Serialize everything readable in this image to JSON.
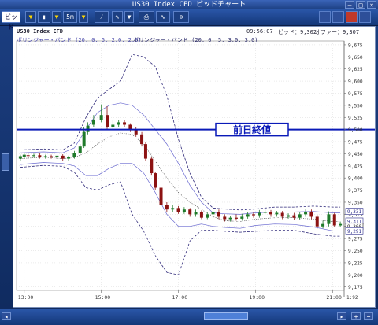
{
  "window": {
    "title": "US30 Index CFD ビッドチャート"
  },
  "toolbar": {
    "bid_label": "ビッド",
    "period_label": "5m"
  },
  "chart_header": {
    "symbol_label": "US30 Index CFD",
    "time": "09:56:07",
    "bid_label": "ビッド：9,302",
    "offer_label": "オファー：9,307",
    "bb1_label": "ボリンジャー・バンド (20, 0, 5, 2.0, 2.0)",
    "bb2_label": "ボリンジャー・バンド (20, 0, 5, 3.0, 3.0)"
  },
  "annotation": {
    "prev_close_label": "前日終値"
  },
  "price_tags": [
    "9,331",
    "9,311",
    "9,300",
    "9,291"
  ],
  "corner_label": "1:92",
  "colors": {
    "up": "#1f7a2a",
    "down": "#8c1212",
    "bb1": "#6a6ad0",
    "bb2": "#302a7a",
    "ma": "#404040",
    "prevclose": "#0a1ab8"
  },
  "chart_data": {
    "type": "line",
    "title": "US30 Index CFD",
    "xlabel": "",
    "ylabel": "",
    "x_ticks": [
      "13:00",
      "15:00",
      "17:00",
      "19:00",
      "21:00"
    ],
    "y_ticks": [
      9175,
      9200,
      9225,
      9250,
      9275,
      9300,
      9325,
      9350,
      9375,
      9400,
      9425,
      9450,
      9475,
      9500,
      9525,
      9550,
      9575,
      9600,
      9625,
      9650,
      9675
    ],
    "y_tick_labels": [
      "9,175",
      "9,200",
      "9,225",
      "9,250",
      "9,275",
      "9,300",
      "9,325",
      "9,350",
      "9,375",
      "9,400",
      "9,425",
      "9,450",
      "9,475",
      "9,500",
      "9,525",
      "9,550",
      "9,575",
      "9,600",
      "9,625",
      "9,650",
      "9,675"
    ],
    "ylim": [
      9168,
      9683
    ],
    "x_range_hours": [
      12.8,
      21.3
    ],
    "prev_close": 9500,
    "candles": [
      {
        "t": 12.9,
        "o": 9440,
        "c": 9445,
        "h": 9448,
        "l": 9436
      },
      {
        "t": 13.0,
        "o": 9444,
        "c": 9448,
        "h": 9452,
        "l": 9440
      },
      {
        "t": 13.1,
        "o": 9447,
        "c": 9446,
        "h": 9452,
        "l": 9442
      },
      {
        "t": 13.25,
        "o": 9446,
        "c": 9447,
        "h": 9450,
        "l": 9442
      },
      {
        "t": 13.4,
        "o": 9447,
        "c": 9443,
        "h": 9451,
        "l": 9440
      },
      {
        "t": 13.55,
        "o": 9443,
        "c": 9445,
        "h": 9448,
        "l": 9440
      },
      {
        "t": 13.7,
        "o": 9445,
        "c": 9444,
        "h": 9448,
        "l": 9440
      },
      {
        "t": 13.85,
        "o": 9444,
        "c": 9446,
        "h": 9450,
        "l": 9440
      },
      {
        "t": 14.0,
        "o": 9446,
        "c": 9440,
        "h": 9449,
        "l": 9436
      },
      {
        "t": 14.15,
        "o": 9440,
        "c": 9443,
        "h": 9446,
        "l": 9436
      },
      {
        "t": 14.3,
        "o": 9443,
        "c": 9452,
        "h": 9456,
        "l": 9440
      },
      {
        "t": 14.45,
        "o": 9452,
        "c": 9465,
        "h": 9470,
        "l": 9450
      },
      {
        "t": 14.55,
        "o": 9465,
        "c": 9495,
        "h": 9505,
        "l": 9462
      },
      {
        "t": 14.65,
        "o": 9495,
        "c": 9508,
        "h": 9515,
        "l": 9490
      },
      {
        "t": 14.8,
        "o": 9510,
        "c": 9520,
        "h": 9530,
        "l": 9505
      },
      {
        "t": 15.0,
        "o": 9520,
        "c": 9530,
        "h": 9552,
        "l": 9515
      },
      {
        "t": 15.15,
        "o": 9530,
        "c": 9505,
        "h": 9548,
        "l": 9500
      },
      {
        "t": 15.3,
        "o": 9505,
        "c": 9510,
        "h": 9520,
        "l": 9500
      },
      {
        "t": 15.45,
        "o": 9510,
        "c": 9515,
        "h": 9520,
        "l": 9505
      },
      {
        "t": 15.6,
        "o": 9515,
        "c": 9510,
        "h": 9520,
        "l": 9505
      },
      {
        "t": 15.75,
        "o": 9510,
        "c": 9500,
        "h": 9513,
        "l": 9495
      },
      {
        "t": 15.9,
        "o": 9500,
        "c": 9490,
        "h": 9505,
        "l": 9485
      },
      {
        "t": 16.05,
        "o": 9490,
        "c": 9470,
        "h": 9495,
        "l": 9465
      },
      {
        "t": 16.15,
        "o": 9470,
        "c": 9440,
        "h": 9475,
        "l": 9435
      },
      {
        "t": 16.3,
        "o": 9440,
        "c": 9410,
        "h": 9444,
        "l": 9405
      },
      {
        "t": 16.4,
        "o": 9410,
        "c": 9380,
        "h": 9412,
        "l": 9376
      },
      {
        "t": 16.55,
        "o": 9380,
        "c": 9345,
        "h": 9383,
        "l": 9340
      },
      {
        "t": 16.7,
        "o": 9345,
        "c": 9335,
        "h": 9350,
        "l": 9330
      },
      {
        "t": 16.85,
        "o": 9335,
        "c": 9338,
        "h": 9345,
        "l": 9330
      },
      {
        "t": 17.0,
        "o": 9338,
        "c": 9330,
        "h": 9342,
        "l": 9326
      },
      {
        "t": 17.15,
        "o": 9330,
        "c": 9335,
        "h": 9340,
        "l": 9326
      },
      {
        "t": 17.3,
        "o": 9335,
        "c": 9325,
        "h": 9338,
        "l": 9320
      },
      {
        "t": 17.45,
        "o": 9325,
        "c": 9330,
        "h": 9335,
        "l": 9320
      },
      {
        "t": 17.6,
        "o": 9330,
        "c": 9318,
        "h": 9333,
        "l": 9315
      },
      {
        "t": 17.75,
        "o": 9318,
        "c": 9325,
        "h": 9330,
        "l": 9315
      },
      {
        "t": 17.9,
        "o": 9325,
        "c": 9330,
        "h": 9335,
        "l": 9320
      },
      {
        "t": 18.05,
        "o": 9330,
        "c": 9320,
        "h": 9335,
        "l": 9315
      },
      {
        "t": 18.2,
        "o": 9320,
        "c": 9315,
        "h": 9325,
        "l": 9310
      },
      {
        "t": 18.35,
        "o": 9315,
        "c": 9318,
        "h": 9322,
        "l": 9310
      },
      {
        "t": 18.5,
        "o": 9318,
        "c": 9316,
        "h": 9325,
        "l": 9312
      },
      {
        "t": 18.65,
        "o": 9316,
        "c": 9320,
        "h": 9326,
        "l": 9312
      },
      {
        "t": 18.8,
        "o": 9320,
        "c": 9325,
        "h": 9330,
        "l": 9316
      },
      {
        "t": 18.95,
        "o": 9325,
        "c": 9323,
        "h": 9330,
        "l": 9318
      },
      {
        "t": 19.1,
        "o": 9323,
        "c": 9328,
        "h": 9334,
        "l": 9318
      },
      {
        "t": 19.25,
        "o": 9328,
        "c": 9330,
        "h": 9335,
        "l": 9325
      },
      {
        "t": 19.4,
        "o": 9330,
        "c": 9325,
        "h": 9334,
        "l": 9320
      },
      {
        "t": 19.55,
        "o": 9325,
        "c": 9328,
        "h": 9332,
        "l": 9320
      },
      {
        "t": 19.7,
        "o": 9328,
        "c": 9320,
        "h": 9332,
        "l": 9315
      },
      {
        "t": 19.85,
        "o": 9320,
        "c": 9323,
        "h": 9327,
        "l": 9316
      },
      {
        "t": 20.0,
        "o": 9323,
        "c": 9318,
        "h": 9328,
        "l": 9313
      },
      {
        "t": 20.15,
        "o": 9318,
        "c": 9325,
        "h": 9330,
        "l": 9314
      },
      {
        "t": 20.3,
        "o": 9325,
        "c": 9330,
        "h": 9335,
        "l": 9320
      },
      {
        "t": 20.45,
        "o": 9330,
        "c": 9320,
        "h": 9335,
        "l": 9315
      },
      {
        "t": 20.6,
        "o": 9320,
        "c": 9300,
        "h": 9325,
        "l": 9295
      },
      {
        "t": 20.75,
        "o": 9300,
        "c": 9305,
        "h": 9312,
        "l": 9296
      },
      {
        "t": 20.9,
        "o": 9305,
        "c": 9325,
        "h": 9331,
        "l": 9300
      },
      {
        "t": 21.05,
        "o": 9325,
        "c": 9302,
        "h": 9328,
        "l": 9298
      },
      {
        "t": 21.2,
        "o": 9302,
        "c": 9305,
        "h": 9310,
        "l": 9298
      }
    ],
    "bands": {
      "t": [
        12.9,
        13.5,
        14.0,
        14.3,
        14.6,
        14.9,
        15.2,
        15.5,
        15.8,
        16.1,
        16.4,
        16.7,
        17.0,
        17.3,
        17.6,
        17.9,
        18.2,
        18.6,
        19.0,
        19.5,
        20.0,
        20.5,
        21.0,
        21.2
      ],
      "mid": [
        9440,
        9443,
        9440,
        9442,
        9452,
        9470,
        9485,
        9493,
        9490,
        9470,
        9435,
        9400,
        9370,
        9350,
        9335,
        9320,
        9312,
        9310,
        9315,
        9318,
        9318,
        9315,
        9310,
        9310
      ],
      "upper2": [
        9452,
        9454,
        9452,
        9462,
        9500,
        9535,
        9550,
        9555,
        9550,
        9530,
        9500,
        9470,
        9430,
        9385,
        9350,
        9328,
        9326,
        9325,
        9328,
        9330,
        9330,
        9331,
        9328,
        9328
      ],
      "lower2": [
        9428,
        9432,
        9430,
        9425,
        9405,
        9405,
        9420,
        9430,
        9430,
        9410,
        9370,
        9325,
        9300,
        9300,
        9305,
        9300,
        9298,
        9296,
        9302,
        9305,
        9304,
        9299,
        9291,
        9291
      ],
      "upper3": [
        9458,
        9460,
        9458,
        9472,
        9525,
        9565,
        9583,
        9600,
        9655,
        9650,
        9630,
        9570,
        9480,
        9410,
        9360,
        9338,
        9336,
        9334,
        9336,
        9340,
        9340,
        9342,
        9340,
        9340
      ],
      "lower3": [
        9422,
        9426,
        9424,
        9412,
        9380,
        9375,
        9386,
        9392,
        9325,
        9290,
        9240,
        9205,
        9200,
        9270,
        9292,
        9292,
        9290,
        9288,
        9290,
        9292,
        9292,
        9285,
        9280,
        9280
      ]
    }
  }
}
